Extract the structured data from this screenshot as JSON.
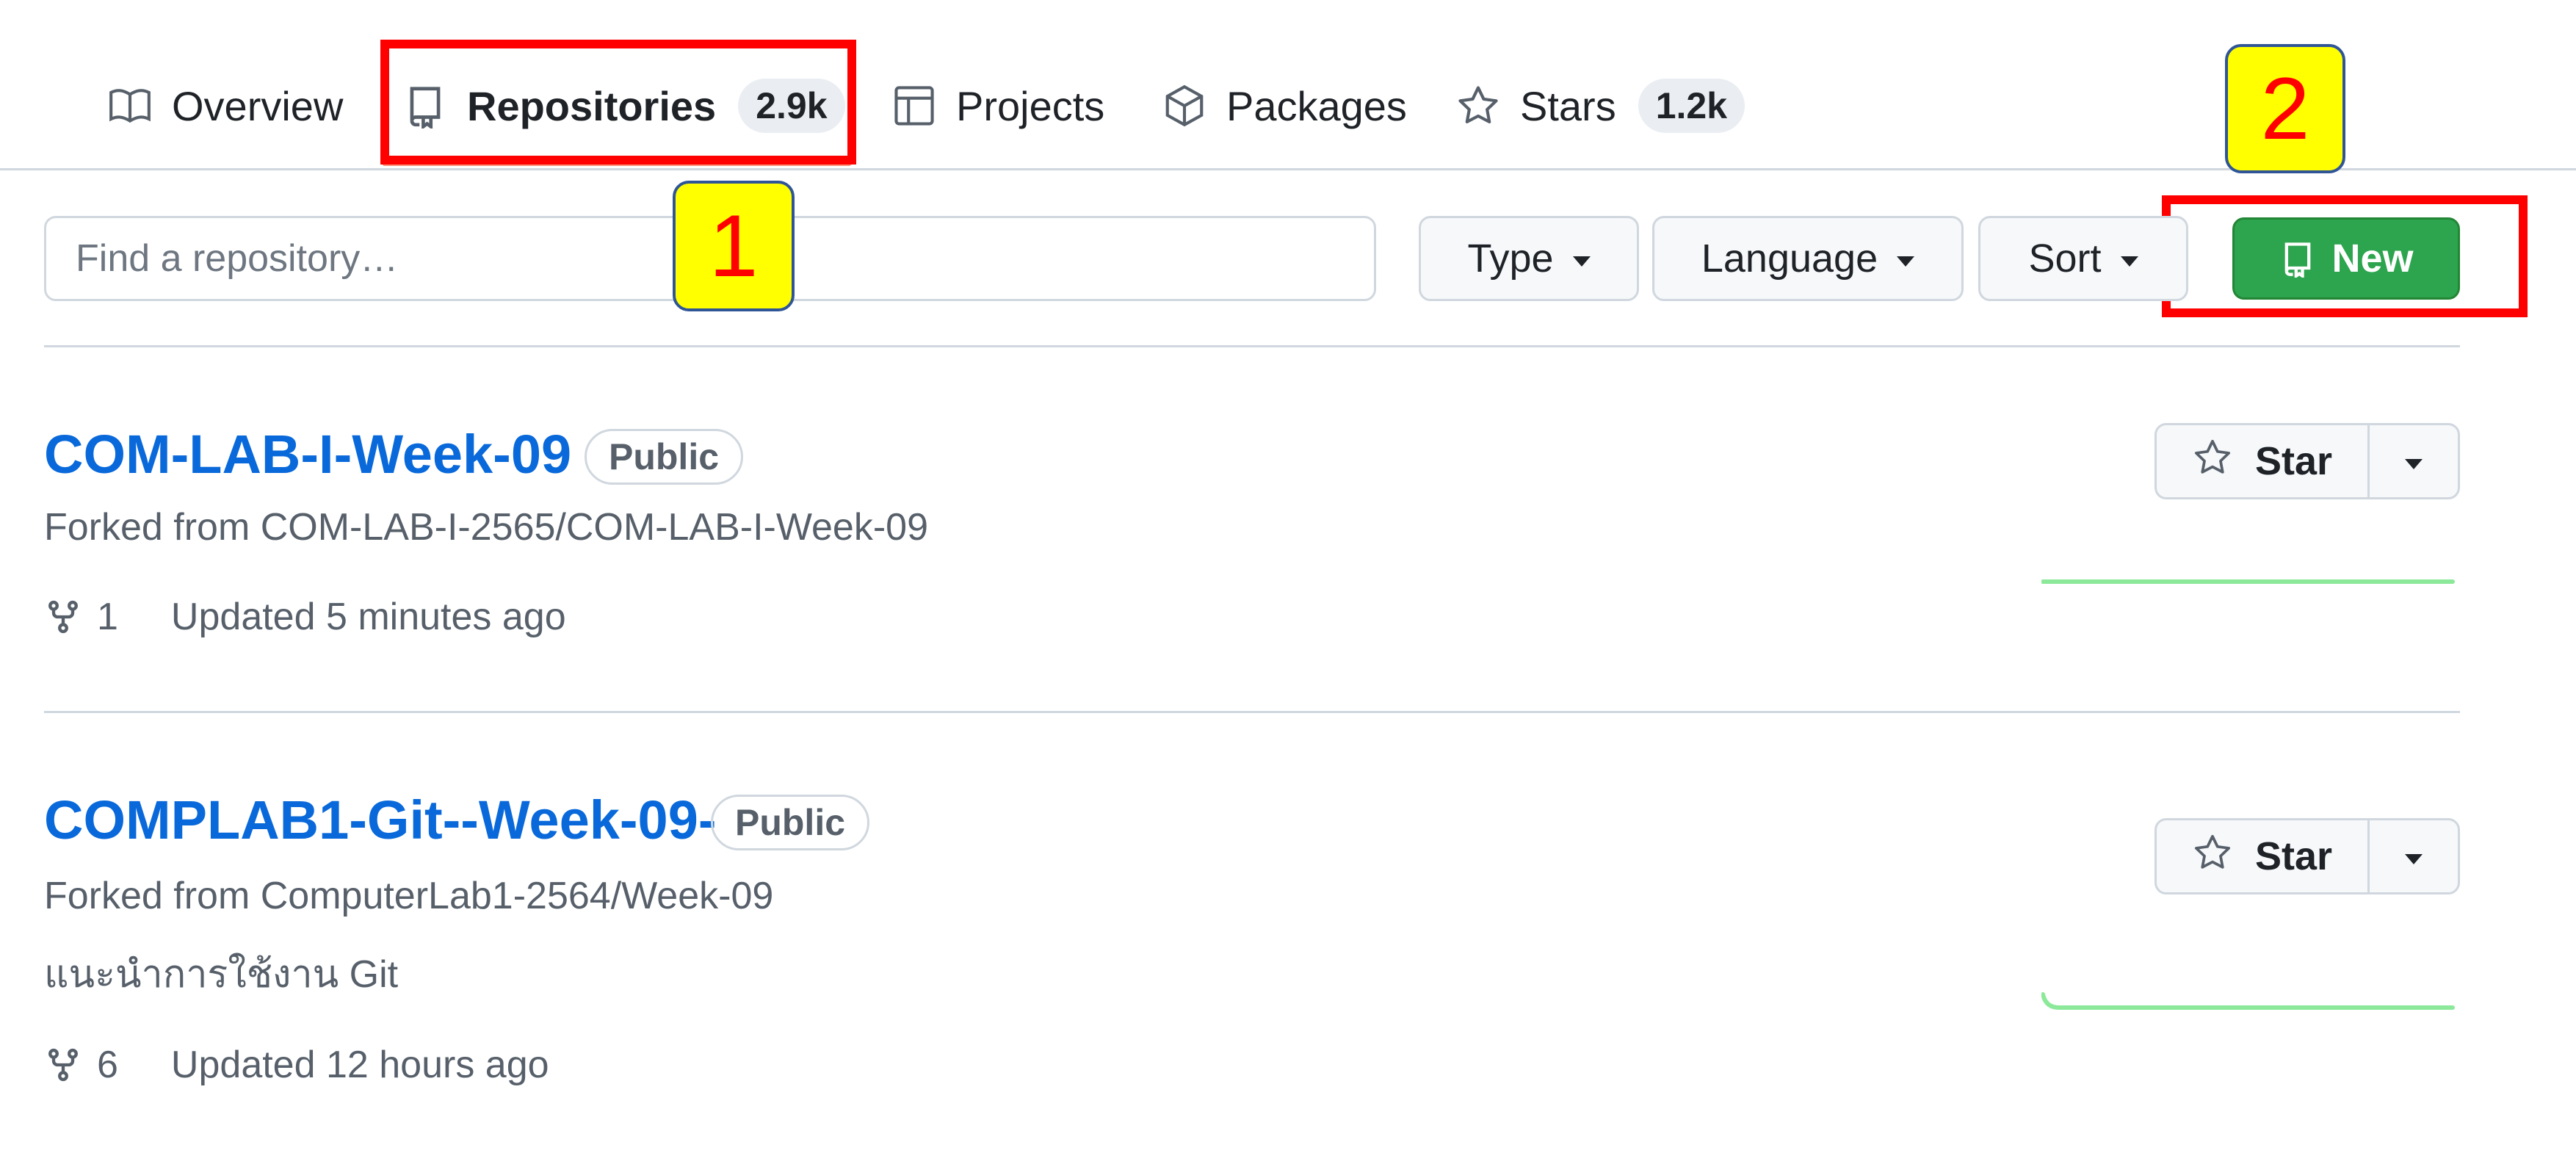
{
  "nav": {
    "tabs": [
      {
        "label": "Overview",
        "icon": "book-icon"
      },
      {
        "label": "Repositories",
        "count": "2.9k",
        "icon": "repo-icon",
        "active": true
      },
      {
        "label": "Projects",
        "icon": "table-icon"
      },
      {
        "label": "Packages",
        "icon": "package-icon"
      },
      {
        "label": "Stars",
        "count": "1.2k",
        "icon": "star-icon"
      }
    ]
  },
  "annotations": {
    "callout_1": "1",
    "callout_2": "2",
    "box_color": "#ff0000",
    "label_bg": "#ffff00"
  },
  "filters": {
    "search_placeholder": "Find a repository…",
    "type_label": "Type",
    "language_label": "Language",
    "sort_label": "Sort",
    "new_label": "New"
  },
  "repos": [
    {
      "name": "COM-LAB-I-Week-09",
      "visibility": "Public",
      "forked_from": "Forked from COM-LAB-I-2565/COM-LAB-I-Week-09",
      "description": "",
      "forks": "1",
      "updated": "Updated 5 minutes ago",
      "star_label": "Star"
    },
    {
      "name": "COMPLAB1-Git--Week-09-",
      "visibility": "Public",
      "forked_from": "Forked from ComputerLab1-2564/Week-09",
      "description": "แนะนำการใช้งาน Git",
      "forks": "6",
      "updated": "Updated 12 hours ago",
      "star_label": "Star"
    }
  ],
  "colors": {
    "link": "#0969da",
    "new_button": "#2da44e",
    "sparkline": "#8ce99a"
  }
}
